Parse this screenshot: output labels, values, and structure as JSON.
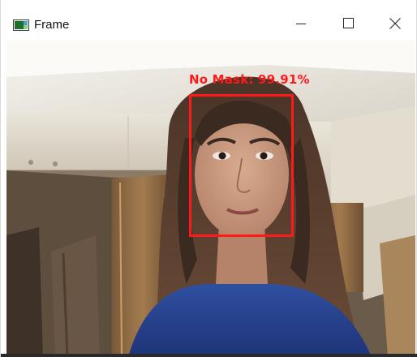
{
  "window": {
    "title": "Frame",
    "icon": "opencv-frame-icon"
  },
  "controls": {
    "minimize_icon": "minimize-icon",
    "maximize_icon": "maximize-icon",
    "close_icon": "close-icon"
  },
  "detection": {
    "label": "No Mask: 99.91%",
    "box_color": "#ff1a1a",
    "confidence_percent": 99.91
  },
  "colors": {
    "titlebar_bg": "#ffffff",
    "detection": "#ff1a1a"
  }
}
